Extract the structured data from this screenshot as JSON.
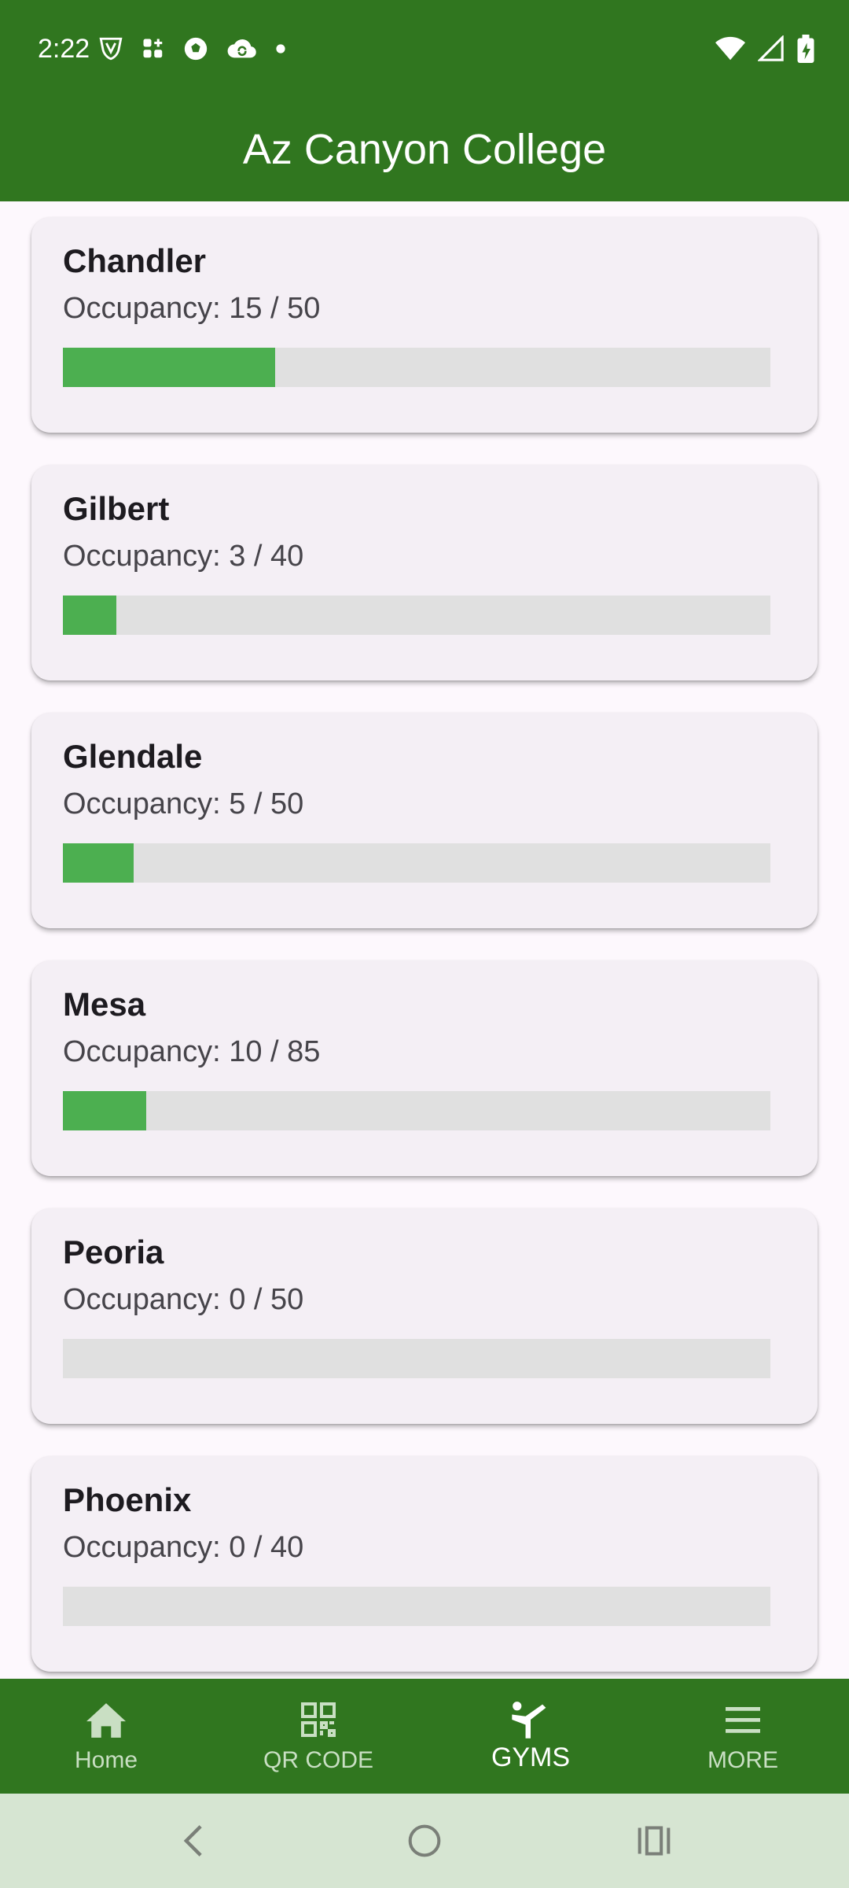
{
  "status_bar": {
    "time": "2:22",
    "left_icons": [
      "vpn-shield-icon",
      "grid-app-icon",
      "soccer-ball-icon",
      "cloud-sync-icon",
      "dot-icon"
    ],
    "right_icons": [
      "wifi-icon",
      "signal-icon",
      "battery-icon"
    ]
  },
  "app_bar": {
    "title": "Az Canyon College"
  },
  "colors": {
    "primary": "#30761f",
    "progress_fill": "#4caf50",
    "progress_track": "#e0e0e0"
  },
  "gyms": [
    {
      "name": "Chandler",
      "occupancy_label": "Occupancy: 15 / 50",
      "current": 15,
      "capacity": 50
    },
    {
      "name": "Gilbert",
      "occupancy_label": "Occupancy: 3 / 40",
      "current": 3,
      "capacity": 40
    },
    {
      "name": "Glendale",
      "occupancy_label": "Occupancy: 5 / 50",
      "current": 5,
      "capacity": 50
    },
    {
      "name": "Mesa",
      "occupancy_label": "Occupancy: 10 / 85",
      "current": 10,
      "capacity": 85
    },
    {
      "name": "Peoria",
      "occupancy_label": "Occupancy: 0 / 50",
      "current": 0,
      "capacity": 50
    },
    {
      "name": "Phoenix",
      "occupancy_label": "Occupancy: 0 / 40",
      "current": 0,
      "capacity": 40
    }
  ],
  "bottom_nav": {
    "items": [
      {
        "label": "Home",
        "icon": "home-icon"
      },
      {
        "label": "QR CODE",
        "icon": "qr-code-icon"
      },
      {
        "label": "GYMS",
        "icon": "gym-figure-icon",
        "active": true
      },
      {
        "label": "MORE",
        "icon": "menu-icon"
      }
    ]
  },
  "system_nav": {
    "buttons": [
      "back-icon",
      "home-circle-icon",
      "recents-icon"
    ]
  }
}
